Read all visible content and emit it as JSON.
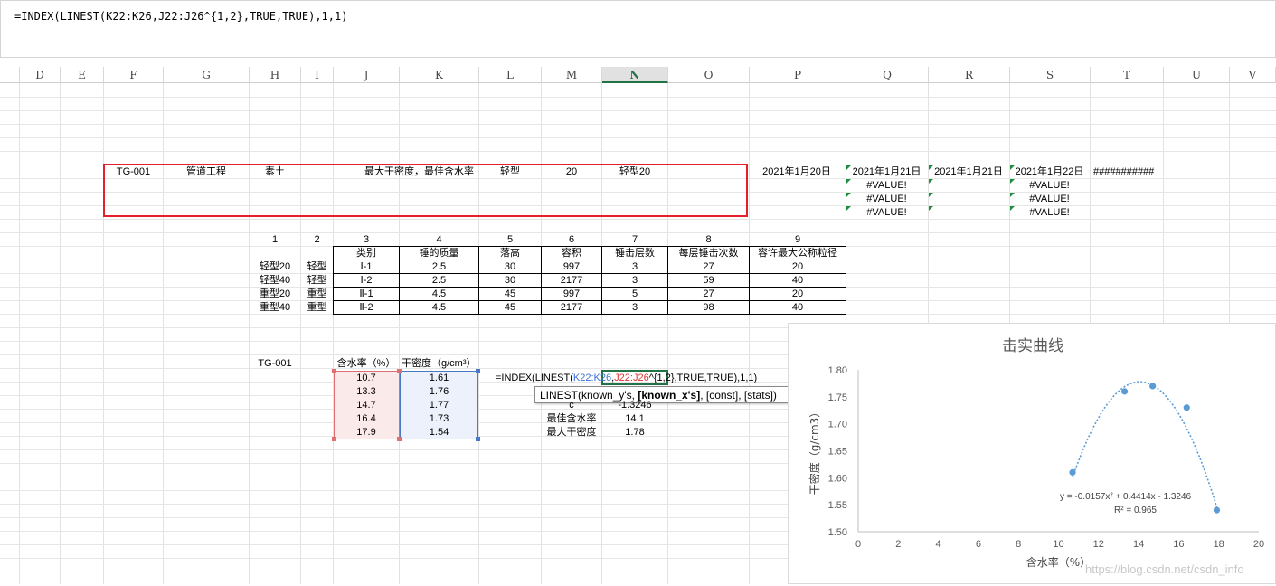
{
  "formula_bar": {
    "text": "=INDEX(LINEST(K22:K26,J22:J26^{1,2},TRUE,TRUE),1,1)"
  },
  "columns": [
    "D",
    "E",
    "F",
    "G",
    "H",
    "I",
    "J",
    "K",
    "L",
    "M",
    "N",
    "O",
    "P",
    "Q",
    "R",
    "S",
    "T",
    "U",
    "V"
  ],
  "selected_column": "N",
  "row_info": {
    "code": "TG-001",
    "project": "管道工程",
    "soil": "素土",
    "title": "最大干密度，最佳含水率",
    "type": "轻型",
    "num": "20",
    "type_num": "轻型20"
  },
  "dates": {
    "p": "2021年1月20日",
    "q": "2021年1月21日",
    "r": "2021年1月21日",
    "s": "2021年1月22日",
    "t": "###########"
  },
  "errors": {
    "q1": "#VALUE!",
    "q2": "#VALUE!",
    "q3": "#VALUE!",
    "s1": "#VALUE!",
    "s2": "#VALUE!",
    "s3": "#VALUE!"
  },
  "std_table": {
    "index_row": [
      "1",
      "2",
      "3",
      "4",
      "5",
      "6",
      "7",
      "8",
      "9"
    ],
    "headers": [
      "类别",
      "锤的质量",
      "落高",
      "容积",
      "锤击层数",
      "每层锤击次数",
      "容许最大公称粒径"
    ],
    "rows": [
      {
        "h": "轻型20",
        "i": "轻型",
        "j": "Ⅰ-1",
        "k": "2.5",
        "l": "30",
        "m": "997",
        "n": "3",
        "o": "27",
        "p": "20"
      },
      {
        "h": "轻型40",
        "i": "轻型",
        "j": "Ⅰ-2",
        "k": "2.5",
        "l": "30",
        "m": "2177",
        "n": "3",
        "o": "59",
        "p": "40"
      },
      {
        "h": "重型20",
        "i": "重型",
        "j": "Ⅱ-1",
        "k": "4.5",
        "l": "45",
        "m": "997",
        "n": "5",
        "o": "27",
        "p": "20"
      },
      {
        "h": "重型40",
        "i": "重型",
        "j": "Ⅱ-2",
        "k": "4.5",
        "l": "45",
        "m": "2177",
        "n": "3",
        "o": "98",
        "p": "40"
      }
    ]
  },
  "test": {
    "code": "TG-001",
    "h_water": "含水率（%）",
    "h_density": "干密度（g/cm³）",
    "rows": [
      {
        "w": "10.7",
        "d": "1.61"
      },
      {
        "w": "13.3",
        "d": "1.76"
      },
      {
        "w": "14.7",
        "d": "1.77"
      },
      {
        "w": "16.4",
        "d": "1.73"
      },
      {
        "w": "17.9",
        "d": "1.54"
      }
    ]
  },
  "edit_formula": {
    "pre": "=INDEX(LINEST(",
    "ref1": "K22:K26",
    "comma": ",",
    "ref2": "J22:J26",
    "post": "^{1,2},TRUE,TRUE),1,1)"
  },
  "tooltip": {
    "p1": "LINEST(known_y's, ",
    "bold": "[known_x's]",
    "p2": ", [const], [stats])"
  },
  "coef": {
    "c_label": "c",
    "c_value": "-1.3246",
    "w_label": "最佳含水率",
    "w_value": "14.1",
    "d_label": "最大干密度",
    "d_value": "1.78"
  },
  "chart_data": {
    "type": "scatter",
    "title": "击实曲线",
    "xlabel": "含水率（%）",
    "ylabel": "干密度（g/cm3）",
    "xlim": [
      0,
      20
    ],
    "ylim": [
      1.5,
      1.8
    ],
    "xticks": [
      "0",
      "2",
      "4",
      "6",
      "8",
      "10",
      "12",
      "14",
      "16",
      "18",
      "20"
    ],
    "yticks": [
      "1.50",
      "1.55",
      "1.60",
      "1.65",
      "1.70",
      "1.75",
      "1.80"
    ],
    "x": [
      10.7,
      13.3,
      14.7,
      16.4,
      17.9
    ],
    "y": [
      1.61,
      1.76,
      1.77,
      1.73,
      1.54
    ],
    "trendline": {
      "type": "polynomial",
      "a": -0.0157,
      "b": 0.4414,
      "c": -1.3246
    },
    "equation": "y = -0.0157x² + 0.4414x - 1.3246",
    "r2": "R² = 0.965",
    "grid": false,
    "color": "#5b9bd5"
  },
  "watermark": "https://blog.csdn.net/csdn_info"
}
